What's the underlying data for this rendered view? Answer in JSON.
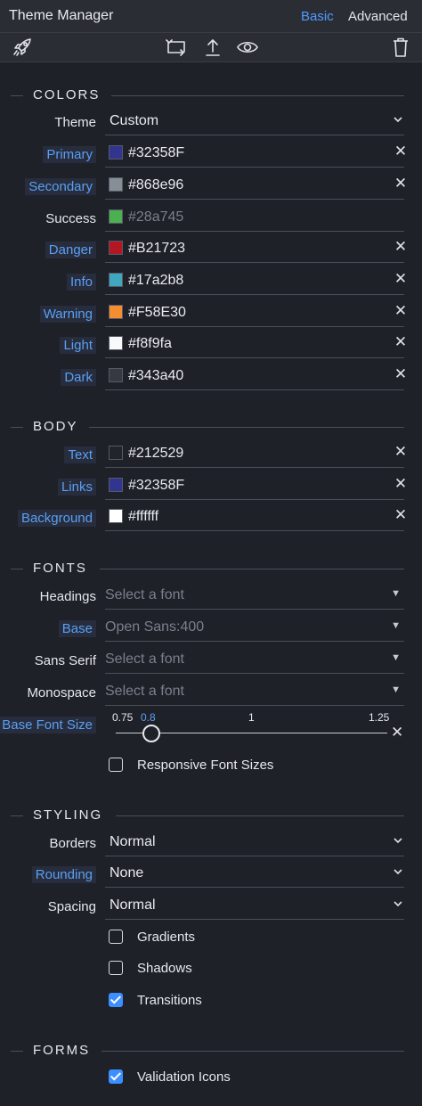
{
  "header": {
    "title": "Theme Manager",
    "modes": {
      "basic": "Basic",
      "advanced": "Advanced"
    }
  },
  "toolbar": {
    "icons": [
      "rocket-icon",
      "convert-icon",
      "upload-icon",
      "eye-icon",
      "trash-icon"
    ]
  },
  "sections": {
    "colors": {
      "title": "COLORS",
      "theme": {
        "label": "Theme",
        "value": "Custom"
      },
      "items": [
        {
          "label": "Primary",
          "hex": "#32358F",
          "color": "#32358F"
        },
        {
          "label": "Secondary",
          "hex": "#868e96",
          "color": "#868e96"
        },
        {
          "label": "Success",
          "hex": "#28a745",
          "color": "#4caf50"
        },
        {
          "label": "Danger",
          "hex": "#B21723",
          "color": "#B21723"
        },
        {
          "label": "Info",
          "hex": "#17a2b8",
          "color": "#3fa8bf"
        },
        {
          "label": "Warning",
          "hex": "#F58E30",
          "color": "#F58E30"
        },
        {
          "label": "Light",
          "hex": "#f8f9fa",
          "color": "#f8f9fa"
        },
        {
          "label": "Dark",
          "hex": "#343a40",
          "color": "#343a40"
        }
      ]
    },
    "body": {
      "title": "BODY",
      "items": [
        {
          "label": "Text",
          "hex": "#212529",
          "color": "#212529"
        },
        {
          "label": "Links",
          "hex": "#32358F",
          "color": "#32358F"
        },
        {
          "label": "Background",
          "hex": "#ffffff",
          "color": "#ffffff"
        }
      ]
    },
    "fonts": {
      "title": "FONTS",
      "headings": {
        "label": "Headings",
        "value": "Select a font"
      },
      "base": {
        "label": "Base",
        "value": "Open Sans:400"
      },
      "sans": {
        "label": "Sans Serif",
        "value": "Select a font"
      },
      "mono": {
        "label": "Monospace",
        "value": "Select a font"
      },
      "size": {
        "label": "Base Font Size",
        "min": "0.75",
        "current": "0.8",
        "mid": "1",
        "max": "1.25",
        "value": 0.8,
        "range": [
          0.75,
          1.25
        ]
      },
      "responsive": {
        "label": "Responsive Font Sizes",
        "checked": false
      }
    },
    "styling": {
      "title": "STYLING",
      "borders": {
        "label": "Borders",
        "value": "Normal"
      },
      "rounding": {
        "label": "Rounding",
        "value": "None"
      },
      "spacing": {
        "label": "Spacing",
        "value": "Normal"
      },
      "gradients": {
        "label": "Gradients",
        "checked": false
      },
      "shadows": {
        "label": "Shadows",
        "checked": false
      },
      "transitions": {
        "label": "Transitions",
        "checked": true
      }
    },
    "forms": {
      "title": "FORMS",
      "validation": {
        "label": "Validation Icons",
        "checked": true
      }
    }
  },
  "colors": {
    "accent": "#4d9bff",
    "background": "#1f2129",
    "bar": "#2b2d35"
  }
}
